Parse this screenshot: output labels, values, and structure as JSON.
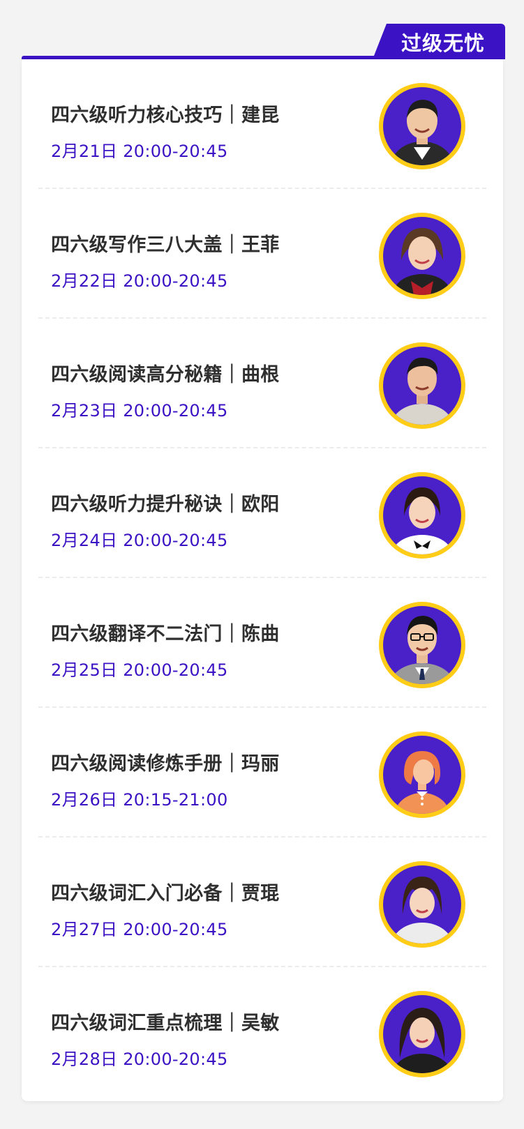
{
  "header": {
    "badge_label": "过级无忧"
  },
  "colors": {
    "accent": "#3b12c4",
    "avatar_ring": "#ffcc17",
    "avatar_bg": "#4a20c9",
    "title_text": "#2f2f2f",
    "page_bg": "#f3f3f3"
  },
  "courses": [
    {
      "title": "四六级听力核心技巧｜建昆",
      "date": "2月21日 20:00-20:45",
      "avatar_icon": "teacher-avatar-male"
    },
    {
      "title": "四六级写作三八大盖｜王菲",
      "date": "2月22日 20:00-20:45",
      "avatar_icon": "teacher-avatar-female"
    },
    {
      "title": "四六级阅读高分秘籍｜曲根",
      "date": "2月23日 20:00-20:45",
      "avatar_icon": "teacher-avatar-male"
    },
    {
      "title": "四六级听力提升秘诀｜欧阳",
      "date": "2月24日 20:00-20:45",
      "avatar_icon": "teacher-avatar-female"
    },
    {
      "title": "四六级翻译不二法门｜陈曲",
      "date": "2月25日 20:00-20:45",
      "avatar_icon": "teacher-avatar-male-glasses"
    },
    {
      "title": "四六级阅读修炼手册｜玛丽",
      "date": "2月26日 20:15-21:00",
      "avatar_icon": "teacher-avatar-illustrated"
    },
    {
      "title": "四六级词汇入门必备｜贾琨",
      "date": "2月27日 20:00-20:45",
      "avatar_icon": "teacher-avatar-female"
    },
    {
      "title": "四六级词汇重点梳理｜吴敏",
      "date": "2月28日 20:00-20:45",
      "avatar_icon": "teacher-avatar-female"
    }
  ]
}
